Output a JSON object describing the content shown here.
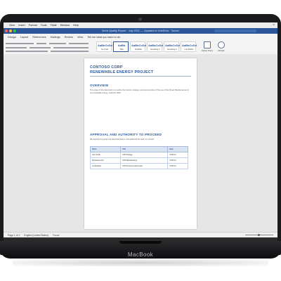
{
  "device": {
    "brand_label": "MacBook"
  },
  "menubar": {
    "items": [
      "View",
      "Insert",
      "Format",
      "Tools",
      "Table",
      "Window",
      "Help"
    ],
    "clock": "••"
  },
  "window": {
    "title": "Word Quality Report · July 2021 — Updated to OneDrive · Saved"
  },
  "ribbon": {
    "tabs": [
      "Design",
      "Layout",
      "References",
      "Mailings",
      "Review",
      "View",
      "Tell me what you want to do"
    ],
    "active_tab": "Home",
    "styles": [
      {
        "sample": "AaBbCcDd",
        "name": "Normal"
      },
      {
        "sample": "AaBb",
        "name": "Title"
      },
      {
        "sample": "AaBbCcDd",
        "name": "Subtitle"
      },
      {
        "sample": "AaBbCcDd",
        "name": "Heading 1"
      },
      {
        "sample": "AaBbCcDd",
        "name": "Heading 2"
      },
      {
        "sample": "AaBbCcDd",
        "name": "List Bullet"
      }
    ],
    "styles_pane_label": "Styles Pane",
    "dictate_label": "Dictate"
  },
  "document": {
    "title_line1": "CONTOSO CORP",
    "title_line2": "RENEWABLE ENERGY PROJECT",
    "section1_heading": "OVERVIEW",
    "section1_body": "The scope of this document is to outline the context, strategy, cost and execution of the use of the Power Module as part of our renewable energy, model for 2022.",
    "section2_heading": "APPROVAL AND AUTHORITY TO PROCEED",
    "section2_body": "We approve the project as described above, and authorize the team to proceed.",
    "table": {
      "headers": [
        "Name",
        "Title",
        "Date"
      ],
      "rows": [
        [
          "John Smith",
          "SVP Strategy",
          "07/01/21"
        ],
        [
          "Bernadette Pan",
          "SVP Manufacturing",
          "07/01/21"
        ],
        [
          "Linda Martin",
          "SVP Environmental Impact",
          "07/01/21"
        ]
      ]
    }
  },
  "statusbar": {
    "page_info": "Page 1 of 1",
    "words": "English (United States)",
    "focus": "Focus"
  },
  "colors": {
    "accent": "#2b579a",
    "heading": "#2d5a9c"
  }
}
